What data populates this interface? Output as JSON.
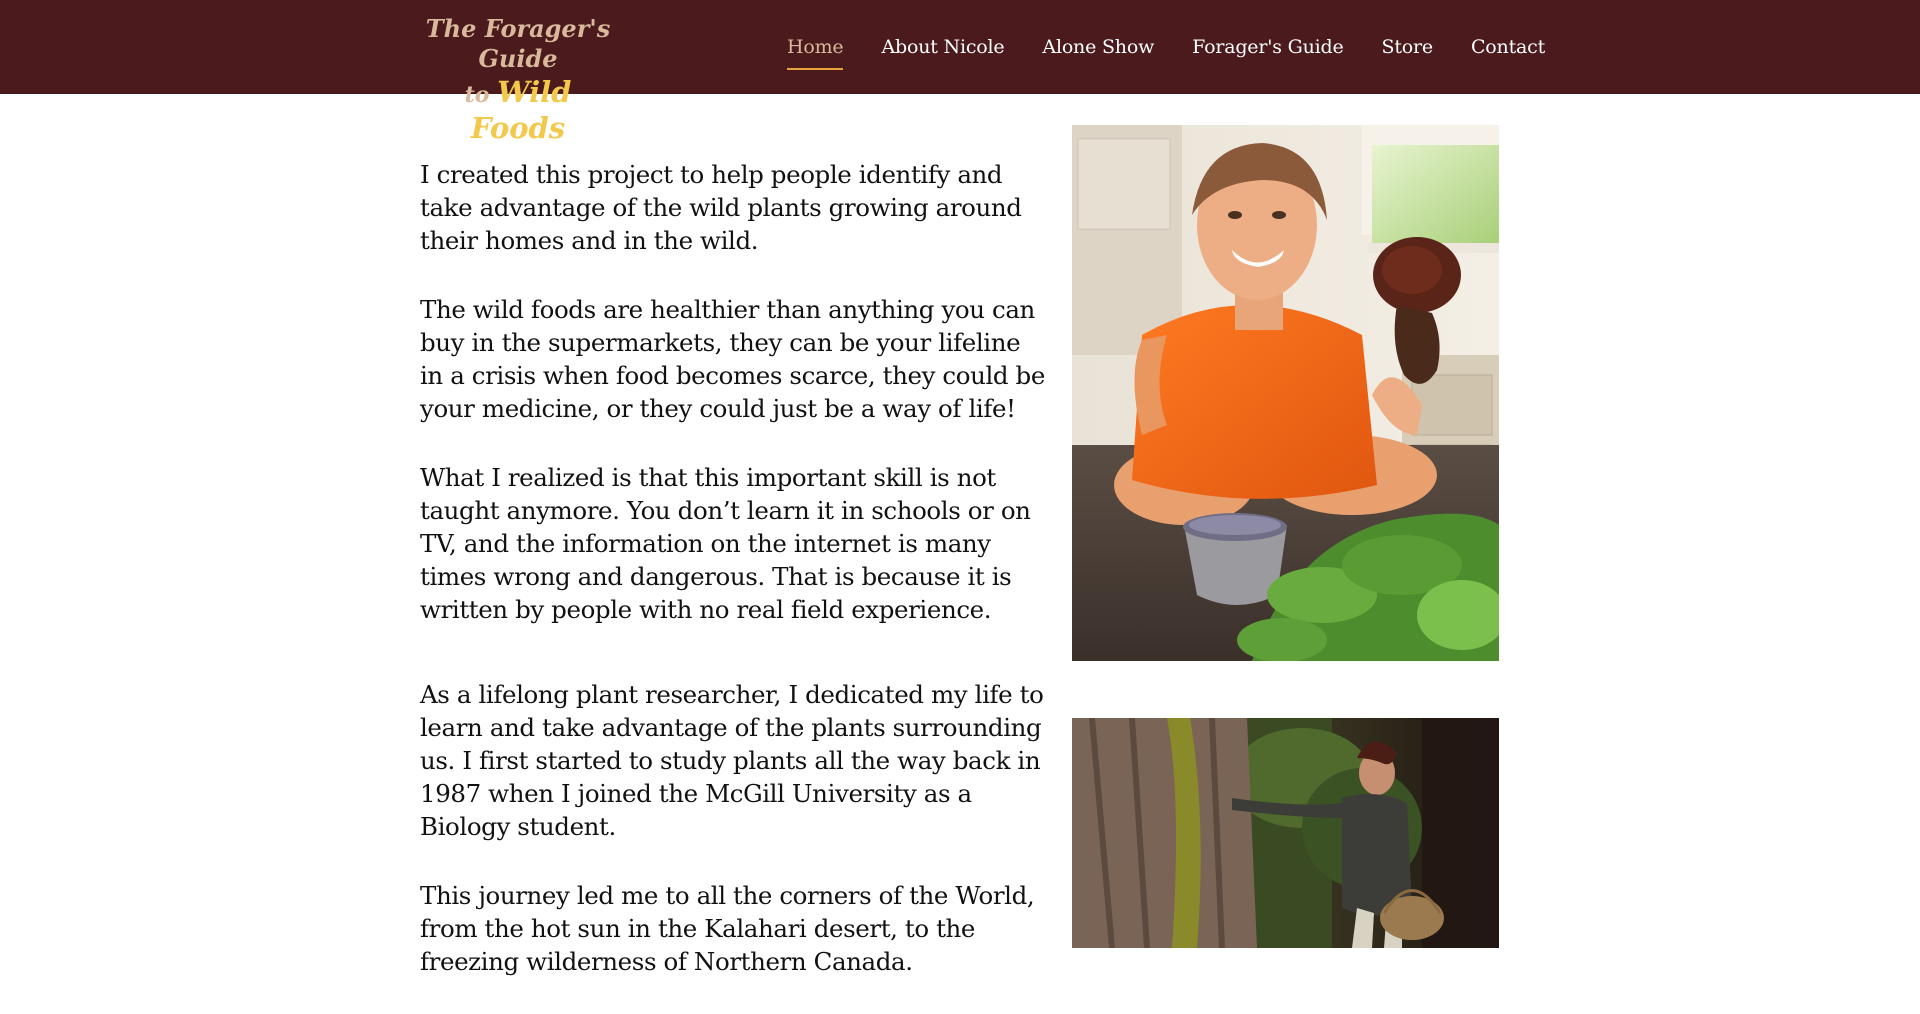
{
  "site": {
    "logo": {
      "line1": "The Forager's Guide",
      "line2_prefix": "to ",
      "line2_accent": "Wild Foods"
    },
    "nav": [
      "Home",
      "About Nicole",
      "Alone Show",
      "Forager's Guide",
      "Store",
      "Contact"
    ]
  },
  "main": {
    "paragraphs": [
      "I created this project to help people identify and take advantage of the wild plants growing around their homes and in the wild.",
      "The wild foods are healthier than anything you can buy in the supermarkets, they can be your lifeline in a crisis when food becomes scarce, they could be your medicine, or they could just be a way of life!",
      "What I realized is that this important skill is not taught anymore. You don’t learn it in schools or on TV, and the information on the internet is many times wrong and dangerous. That is because it is written by people with no real field experience.",
      "As a lifelong plant researcher, I dedicated my life to learn and take advantage of the plants surrounding us. I first started to study plants all the way back in 1987 when I joined the McGill University as a Biology student.",
      "This journey led me to all the corners of the World, from the hot sun in the Kalahari desert, to the freezing wilderness of Northern Canada."
    ]
  },
  "colors": {
    "header_bg": "#4a1a1d",
    "nav_active": "#d9b99b",
    "nav_underline": "#e8a33d",
    "logo_accent": "#f2c94c"
  }
}
